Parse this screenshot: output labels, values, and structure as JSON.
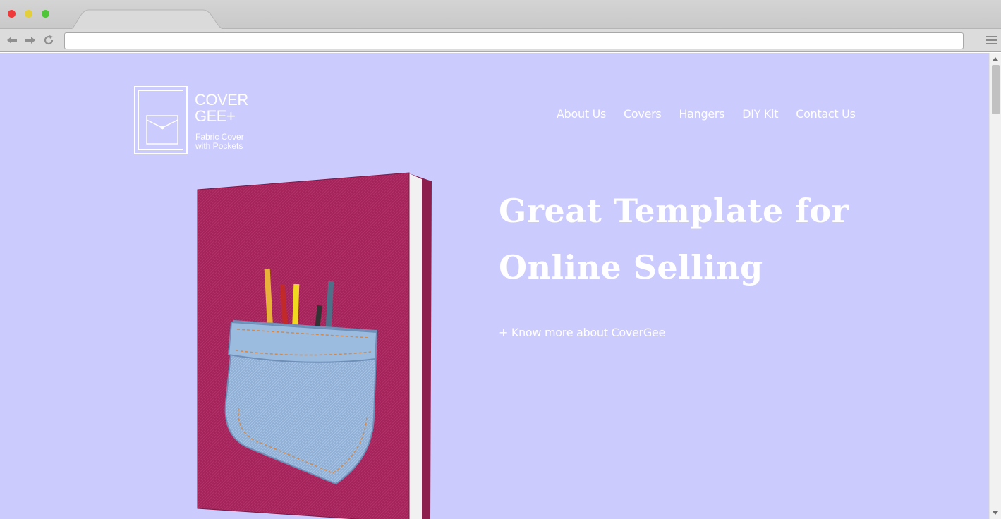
{
  "browser": {
    "address_value": "",
    "colors": {
      "close": "#ee3a3a",
      "minimize": "#e3cf3c",
      "maximize": "#4fc53a"
    }
  },
  "page": {
    "background": "#cccbfd",
    "logo": {
      "title_line1": "COVER",
      "title_line2": "GEE+",
      "tagline_line1": "Fabric Cover",
      "tagline_line2": "with Pockets"
    },
    "nav": [
      {
        "label": "About Us"
      },
      {
        "label": "Covers"
      },
      {
        "label": "Hangers"
      },
      {
        "label": "DIY Kit"
      },
      {
        "label": "Contact Us"
      }
    ],
    "hero": {
      "title_line1": "Great Template for",
      "title_line2": "Online Selling",
      "link": "+ Know more about CoverGee"
    },
    "book": {
      "cover_color": "#a32458",
      "pocket_color": "#8fb0d6"
    }
  }
}
